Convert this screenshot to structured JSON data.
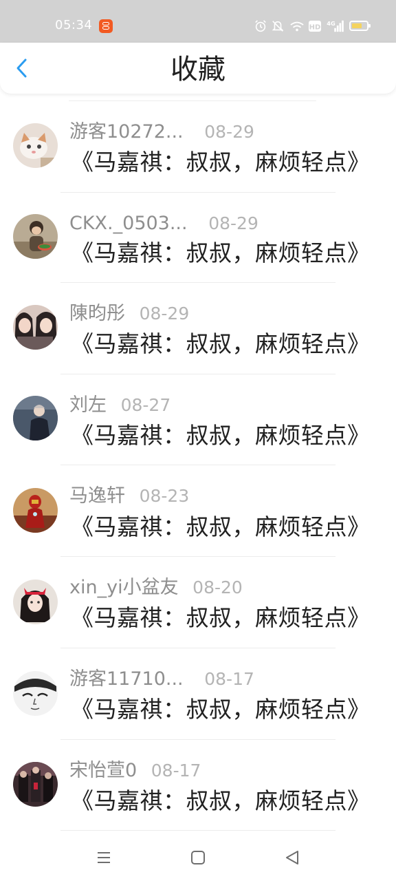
{
  "status_bar": {
    "time": "05:34",
    "icons": [
      "app-badge-icon",
      "alarm-icon",
      "mute-icon",
      "wifi-icon",
      "hd-icon",
      "signal-4g-icon",
      "battery-icon"
    ],
    "battery_color": "#f4d35e"
  },
  "header": {
    "title": "收藏",
    "back_icon": "chevron-left-icon",
    "accent": "#2b9cf0"
  },
  "items": [
    {
      "user": "游客10272...",
      "date": "08-29",
      "text": "《马嘉祺：叔叔，麻烦轻点》",
      "avatar": "cat-photo"
    },
    {
      "user": "CKX._0503...",
      "date": "08-29",
      "text": "《马嘉祺：叔叔，麻烦轻点》",
      "avatar": "child-photo"
    },
    {
      "user": "陳昀彤",
      "date": "08-29",
      "text": "《马嘉祺：叔叔，麻烦轻点》",
      "avatar": "two-girls-photo"
    },
    {
      "user": "刘左",
      "date": "08-27",
      "text": "《马嘉祺：叔叔，麻烦轻点》",
      "avatar": "person-lake-photo"
    },
    {
      "user": "马逸轩",
      "date": "08-23",
      "text": "《马嘉祺：叔叔，麻烦轻点》",
      "avatar": "iron-man-photo"
    },
    {
      "user": "xin_yi小盆友",
      "date": "08-20",
      "text": "《马嘉祺：叔叔，麻烦轻点》",
      "avatar": "girl-headband-photo"
    },
    {
      "user": "游客11710...",
      "date": "08-17",
      "text": "《马嘉祺：叔叔，麻烦轻点》",
      "avatar": "sketch-face-photo"
    },
    {
      "user": "宋怡萱0",
      "date": "08-17",
      "text": "《马嘉祺：叔叔，麻烦轻点》",
      "avatar": "dark-group-photo"
    }
  ],
  "nav_bar": {
    "buttons": [
      "menu-icon",
      "home-icon",
      "back-triangle-icon"
    ]
  }
}
